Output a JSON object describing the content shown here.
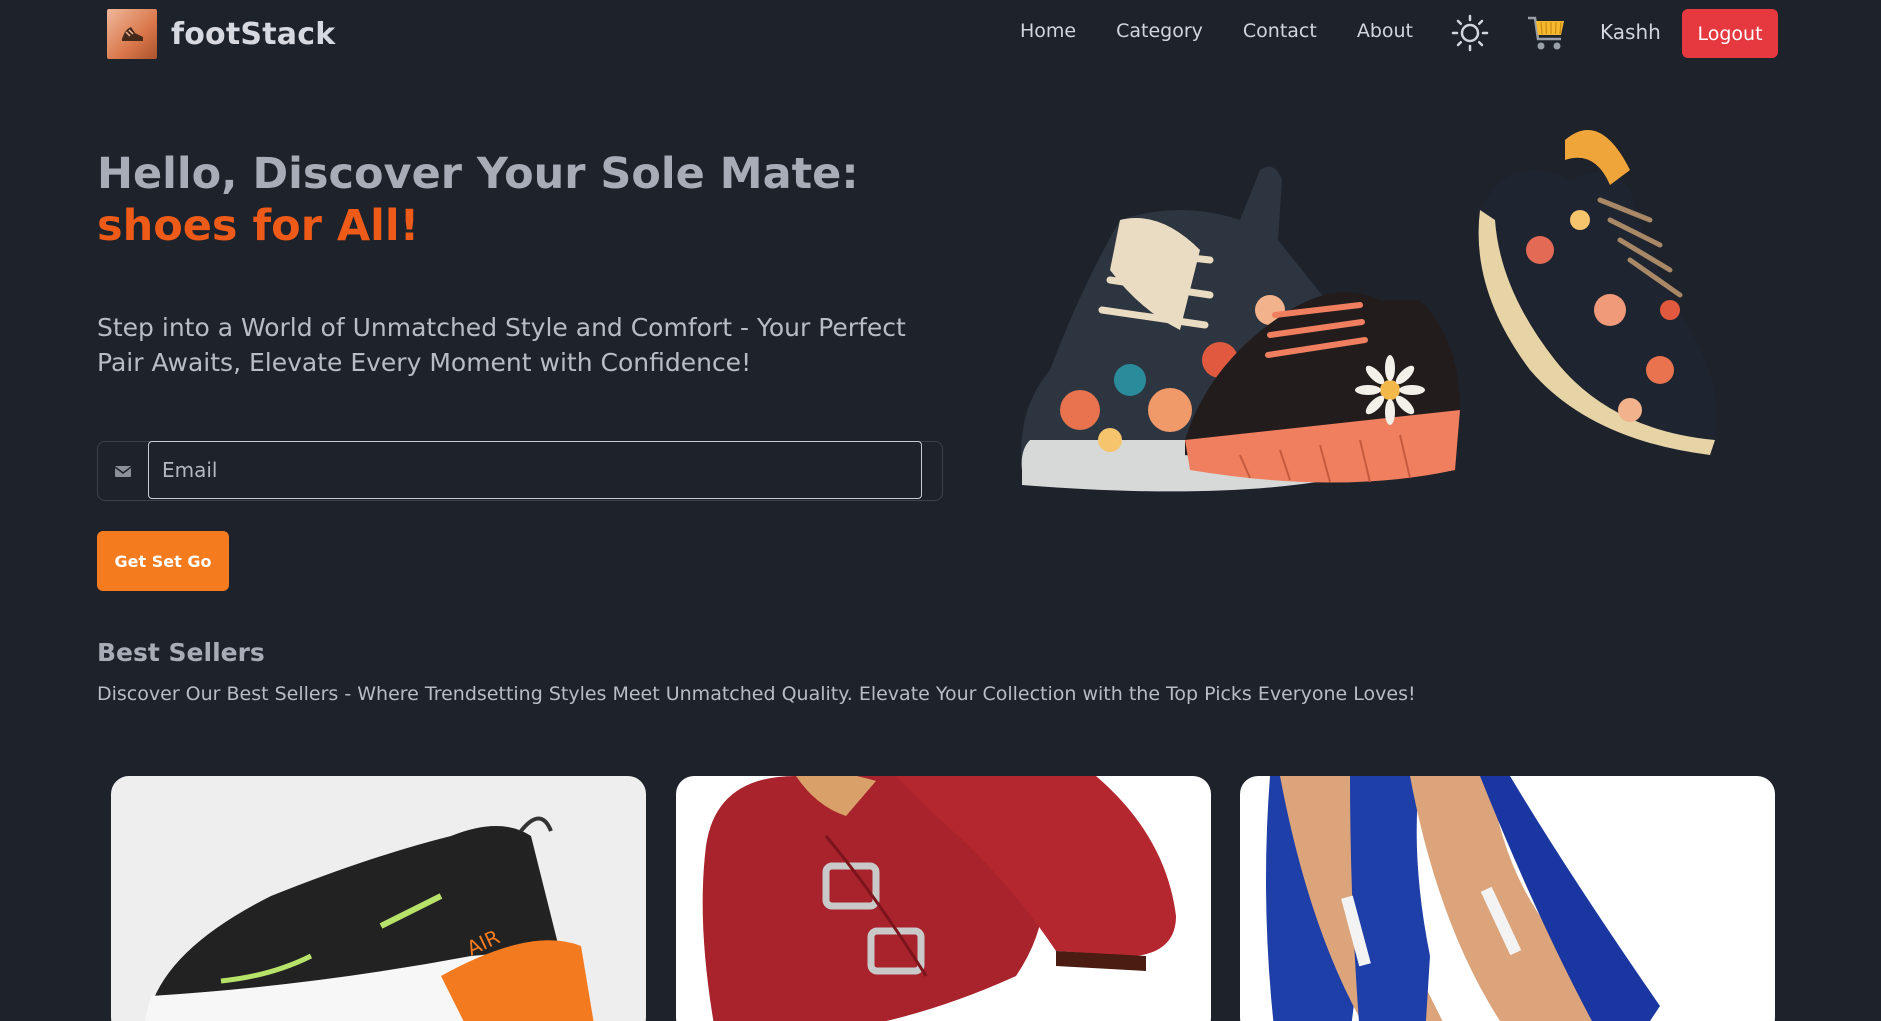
{
  "brand": {
    "name": "footStack"
  },
  "nav": {
    "links": [
      "Home",
      "Category",
      "Contact",
      "About"
    ],
    "username": "Kashh",
    "logout_label": "Logout"
  },
  "hero": {
    "title_line1": "Hello, Discover Your Sole Mate:",
    "title_line2": "shoes for All!",
    "subtitle": "Step into a World of Unmatched Style and Comfort - Your Perfect Pair Awaits, Elevate Every Moment with Confidence!",
    "email_placeholder": "Email",
    "cta_label": "Get Set Go"
  },
  "best_sellers": {
    "title": "Best Sellers",
    "description": "Discover Our Best Sellers - Where Trendsetting Styles Meet Unmatched Quality. Elevate Your Collection with the Top Picks Everyone Loves!",
    "products": [
      {
        "image": "black-orange-sneaker"
      },
      {
        "image": "red-monk-strap-shoes"
      },
      {
        "image": "blue-high-heels"
      }
    ]
  },
  "colors": {
    "background": "#1e222b",
    "accent": "#ee5a18",
    "cta": "#f57b1f",
    "logout": "#e5383f",
    "cart": "#f5b82e"
  },
  "icons": [
    "sun-icon",
    "cart-icon",
    "envelope-icon",
    "logo-icon"
  ]
}
